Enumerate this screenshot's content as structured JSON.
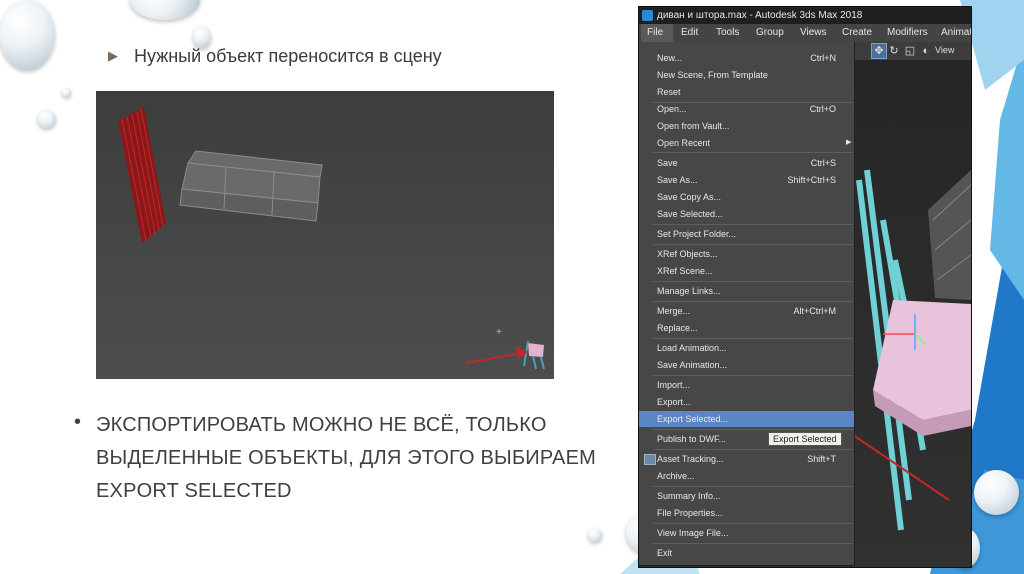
{
  "slide": {
    "bullet1_marker": "▶",
    "title": "Нужный объект переносится в сцену",
    "bullet2_marker": "•",
    "body": [
      "ЭКСПОРТИРОВАТЬ МОЖНО НЕ ВСЁ, ТОЛЬКО",
      "ВЫДЕЛЕННЫЕ ОБЪЕКТЫ, ДЛЯ ЭТОГО ВЫБИРАЕМ",
      "EXPORT SELECTED"
    ]
  },
  "window": {
    "title": "диван и штора.max - Autodesk 3ds Max 2018",
    "view_label": "View"
  },
  "menubar": [
    "File",
    "Edit",
    "Tools",
    "Group",
    "Views",
    "Create",
    "Modifiers",
    "Animat"
  ],
  "file_menu": [
    {
      "label": "New...",
      "shortcut": "Ctrl+N"
    },
    {
      "label": "New Scene, From Template",
      "shortcut": ""
    },
    {
      "label": "Reset",
      "shortcut": ""
    },
    {
      "label": "Open...",
      "shortcut": "Ctrl+O"
    },
    {
      "label": "Open from Vault...",
      "shortcut": ""
    },
    {
      "label": "Open Recent",
      "shortcut": ""
    },
    {
      "label": "Save",
      "shortcut": "Ctrl+S"
    },
    {
      "label": "Save As...",
      "shortcut": "Shift+Ctrl+S"
    },
    {
      "label": "Save Copy As...",
      "shortcut": ""
    },
    {
      "label": "Save Selected...",
      "shortcut": ""
    },
    {
      "label": "Set Project Folder...",
      "shortcut": ""
    },
    {
      "label": "XRef Objects...",
      "shortcut": ""
    },
    {
      "label": "XRef Scene...",
      "shortcut": ""
    },
    {
      "label": "Manage Links...",
      "shortcut": ""
    },
    {
      "label": "Merge...",
      "shortcut": "Alt+Ctrl+M"
    },
    {
      "label": "Replace...",
      "shortcut": ""
    },
    {
      "label": "Load Animation...",
      "shortcut": ""
    },
    {
      "label": "Save Animation...",
      "shortcut": ""
    },
    {
      "label": "Import...",
      "shortcut": ""
    },
    {
      "label": "Export...",
      "shortcut": ""
    },
    {
      "label": "Export Selected...",
      "shortcut": ""
    },
    {
      "label": "Publish to DWF...",
      "shortcut": ""
    },
    {
      "label": "Asset Tracking...",
      "shortcut": "Shift+T"
    },
    {
      "label": "Archive...",
      "shortcut": ""
    },
    {
      "label": "Summary Info...",
      "shortcut": ""
    },
    {
      "label": "File Properties...",
      "shortcut": ""
    },
    {
      "label": "View Image File...",
      "shortcut": ""
    },
    {
      "label": "Exit",
      "shortcut": ""
    }
  ],
  "tooltip": "Export Selected",
  "colors": {
    "highlight": "#5a86c4",
    "menu_bg": "#474747",
    "arrow": "#c0282a"
  }
}
